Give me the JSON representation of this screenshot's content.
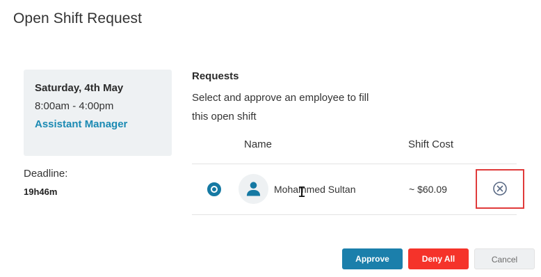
{
  "dialog": {
    "title": "Open Shift Request"
  },
  "shift": {
    "date": "Saturday, 4th May",
    "time": "8:00am - 4:00pm",
    "role": "Assistant Manager"
  },
  "deadline": {
    "label": "Deadline:",
    "value": "19h46m"
  },
  "requests": {
    "title": "Requests",
    "description": "Select and approve an employee to fill this open shift",
    "columns": {
      "name": "Name",
      "cost": "Shift Cost"
    },
    "rows": [
      {
        "selected": true,
        "name": "Mohammed Sultan",
        "cost": "~ $60.09",
        "avatar_icon": "person-icon",
        "remove_icon": "close-circle-icon"
      }
    ]
  },
  "actions": {
    "approve": "Approve",
    "deny_all": "Deny All",
    "cancel": "Cancel"
  },
  "colors": {
    "primary": "#1b7fab",
    "danger": "#f5332a",
    "highlight": "#e03a3a",
    "role_link": "#1b8ab3"
  }
}
